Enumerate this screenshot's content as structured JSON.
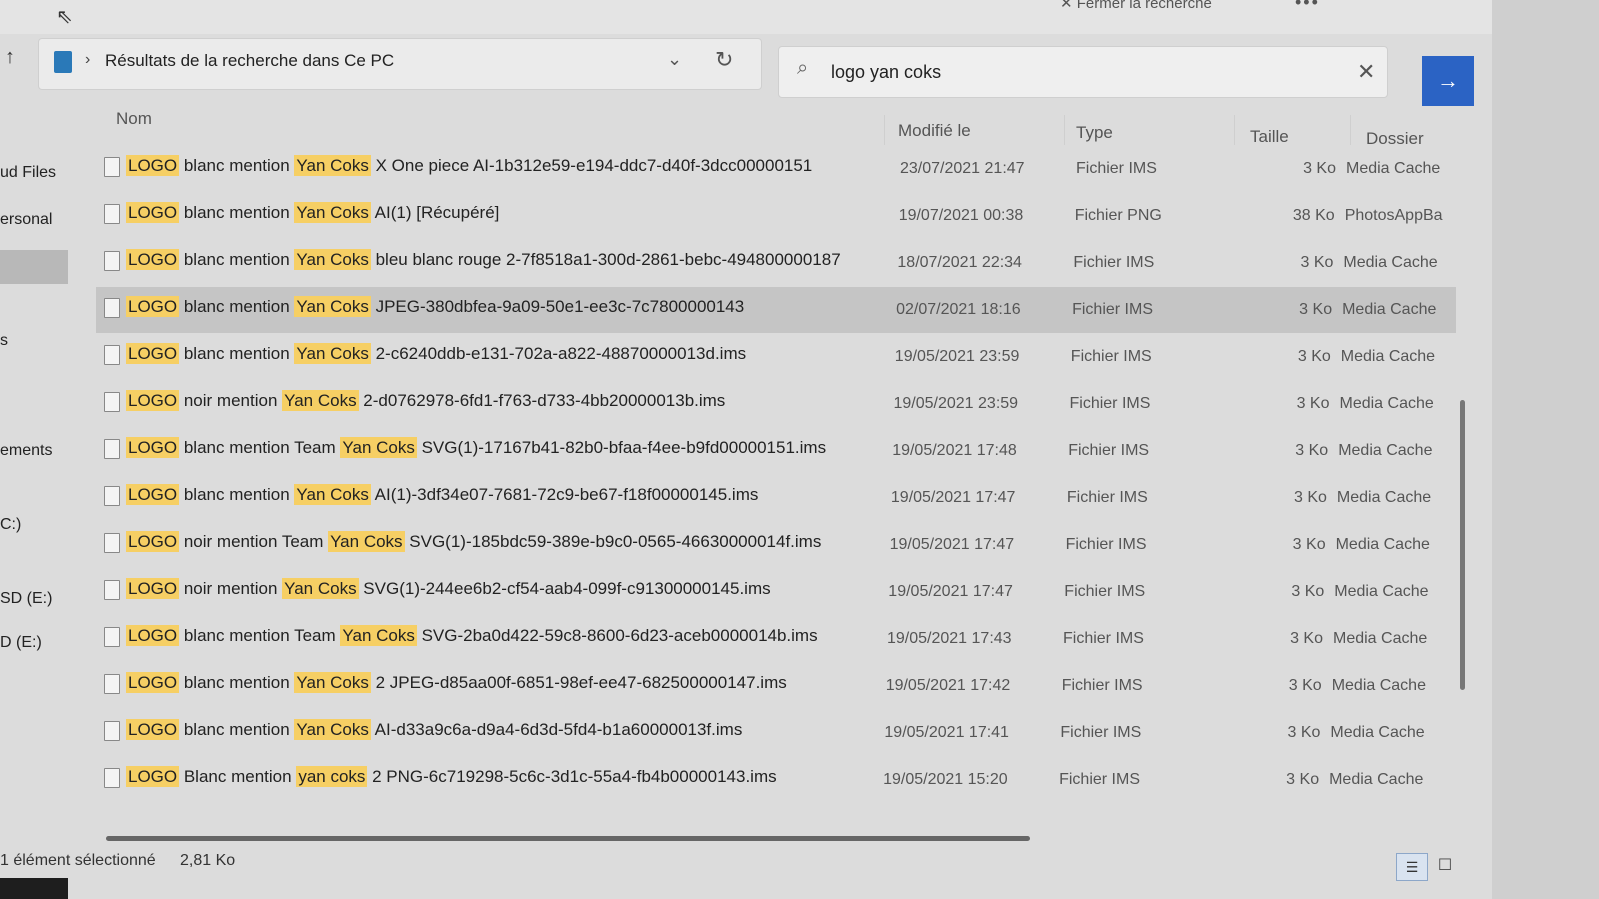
{
  "topbar": {
    "close_search_label": "✕ Fermer la recherche",
    "more_label": "•••"
  },
  "address": {
    "path": "Résultats de la recherche dans Ce PC"
  },
  "search": {
    "value": "logo yan coks"
  },
  "sidebar": {
    "items": [
      "ud Files",
      "ersonal",
      "s",
      "ements",
      "C:)",
      "SD (E:)",
      "D (E:)"
    ]
  },
  "columns": {
    "name": "Nom",
    "modified": "Modifié le",
    "type": "Type",
    "size": "Taille",
    "folder": "Dossier"
  },
  "rows": [
    {
      "parts": [
        [
          "LOGO",
          true
        ],
        [
          " blanc mention ",
          false
        ],
        [
          "Yan Coks",
          true
        ],
        [
          " X One piece AI-1b312e59-e194-ddc7-d40f-3dcc00000151",
          false
        ]
      ],
      "date": "23/07/2021 21:47",
      "type": "Fichier IMS",
      "size": "3 Ko",
      "folder": "Media Cache",
      "selected": false
    },
    {
      "parts": [
        [
          "LOGO",
          true
        ],
        [
          " blanc mention ",
          false
        ],
        [
          "Yan Coks",
          true
        ],
        [
          " AI(1) [Récupéré]",
          false
        ]
      ],
      "date": "19/07/2021 00:38",
      "type": "Fichier PNG",
      "size": "38 Ko",
      "folder": "PhotosAppBa",
      "selected": false
    },
    {
      "parts": [
        [
          "LOGO",
          true
        ],
        [
          " blanc mention ",
          false
        ],
        [
          "Yan Coks",
          true
        ],
        [
          " bleu blanc rouge 2-7f8518a1-300d-2861-bebc-494800000187",
          false
        ]
      ],
      "date": "18/07/2021 22:34",
      "type": "Fichier IMS",
      "size": "3 Ko",
      "folder": "Media Cache",
      "selected": false
    },
    {
      "parts": [
        [
          "LOGO",
          true
        ],
        [
          " blanc mention ",
          false
        ],
        [
          "Yan Coks",
          true
        ],
        [
          " JPEG-380dbfea-9a09-50e1-ee3c-7c7800000143",
          false
        ]
      ],
      "date": "02/07/2021 18:16",
      "type": "Fichier IMS",
      "size": "3 Ko",
      "folder": "Media Cache",
      "selected": true
    },
    {
      "parts": [
        [
          "LOGO",
          true
        ],
        [
          " blanc mention ",
          false
        ],
        [
          "Yan Coks",
          true
        ],
        [
          " 2-c6240ddb-e131-702a-a822-48870000013d.ims",
          false
        ]
      ],
      "date": "19/05/2021 23:59",
      "type": "Fichier IMS",
      "size": "3 Ko",
      "folder": "Media Cache",
      "selected": false
    },
    {
      "parts": [
        [
          "LOGO",
          true
        ],
        [
          " noir mention ",
          false
        ],
        [
          "Yan Coks",
          true
        ],
        [
          " 2-d0762978-6fd1-f763-d733-4bb20000013b.ims",
          false
        ]
      ],
      "date": "19/05/2021 23:59",
      "type": "Fichier IMS",
      "size": "3 Ko",
      "folder": "Media Cache",
      "selected": false
    },
    {
      "parts": [
        [
          "LOGO",
          true
        ],
        [
          " blanc mention Team ",
          false
        ],
        [
          "Yan Coks",
          true
        ],
        [
          " SVG(1)-17167b41-82b0-bfaa-f4ee-b9fd00000151.ims",
          false
        ]
      ],
      "date": "19/05/2021 17:48",
      "type": "Fichier IMS",
      "size": "3 Ko",
      "folder": "Media Cache",
      "selected": false
    },
    {
      "parts": [
        [
          "LOGO",
          true
        ],
        [
          " blanc mention ",
          false
        ],
        [
          "Yan Coks",
          true
        ],
        [
          " AI(1)-3df34e07-7681-72c9-be67-f18f00000145.ims",
          false
        ]
      ],
      "date": "19/05/2021 17:47",
      "type": "Fichier IMS",
      "size": "3 Ko",
      "folder": "Media Cache",
      "selected": false
    },
    {
      "parts": [
        [
          "LOGO",
          true
        ],
        [
          " noir mention Team ",
          false
        ],
        [
          "Yan Coks",
          true
        ],
        [
          " SVG(1)-185bdc59-389e-b9c0-0565-46630000014f.ims",
          false
        ]
      ],
      "date": "19/05/2021 17:47",
      "type": "Fichier IMS",
      "size": "3 Ko",
      "folder": "Media Cache",
      "selected": false
    },
    {
      "parts": [
        [
          "LOGO",
          true
        ],
        [
          " noir mention ",
          false
        ],
        [
          "Yan Coks",
          true
        ],
        [
          " SVG(1)-244ee6b2-cf54-aab4-099f-c91300000145.ims",
          false
        ]
      ],
      "date": "19/05/2021 17:47",
      "type": "Fichier IMS",
      "size": "3 Ko",
      "folder": "Media Cache",
      "selected": false
    },
    {
      "parts": [
        [
          "LOGO",
          true
        ],
        [
          " blanc mention Team ",
          false
        ],
        [
          "Yan Coks",
          true
        ],
        [
          " SVG-2ba0d422-59c8-8600-6d23-aceb0000014b.ims",
          false
        ]
      ],
      "date": "19/05/2021 17:43",
      "type": "Fichier IMS",
      "size": "3 Ko",
      "folder": "Media Cache",
      "selected": false
    },
    {
      "parts": [
        [
          "LOGO",
          true
        ],
        [
          " blanc mention ",
          false
        ],
        [
          "Yan Coks",
          true
        ],
        [
          " 2 JPEG-d85aa00f-6851-98ef-ee47-682500000147.ims",
          false
        ]
      ],
      "date": "19/05/2021 17:42",
      "type": "Fichier IMS",
      "size": "3 Ko",
      "folder": "Media Cache",
      "selected": false
    },
    {
      "parts": [
        [
          "LOGO",
          true
        ],
        [
          " blanc mention ",
          false
        ],
        [
          "Yan Coks",
          true
        ],
        [
          " AI-d33a9c6a-d9a4-6d3d-5fd4-b1a60000013f.ims",
          false
        ]
      ],
      "date": "19/05/2021 17:41",
      "type": "Fichier IMS",
      "size": "3 Ko",
      "folder": "Media Cache",
      "selected": false
    },
    {
      "parts": [
        [
          "LOGO",
          true
        ],
        [
          " Blanc mention ",
          false
        ],
        [
          "yan coks",
          true
        ],
        [
          " 2 PNG-6c719298-5c6c-3d1c-55a4-fb4b00000143.ims",
          false
        ]
      ],
      "date": "19/05/2021 15:20",
      "type": "Fichier IMS",
      "size": "3 Ko",
      "folder": "Media Cache",
      "selected": false
    }
  ],
  "status": {
    "selection": "1 élément sélectionné",
    "size": "2,81 Ko"
  },
  "colors": {
    "highlight": "#f6cf64",
    "accent": "#2b63c4",
    "selected_row": "#c5c5c5"
  },
  "icons": [
    "cursor-icon",
    "up-arrow-icon",
    "pc-icon",
    "chevron-right-icon",
    "chevron-down-icon",
    "refresh-icon",
    "search-icon",
    "clear-icon",
    "arrow-right-icon",
    "file-icon",
    "details-view-icon",
    "tiles-view-icon"
  ]
}
